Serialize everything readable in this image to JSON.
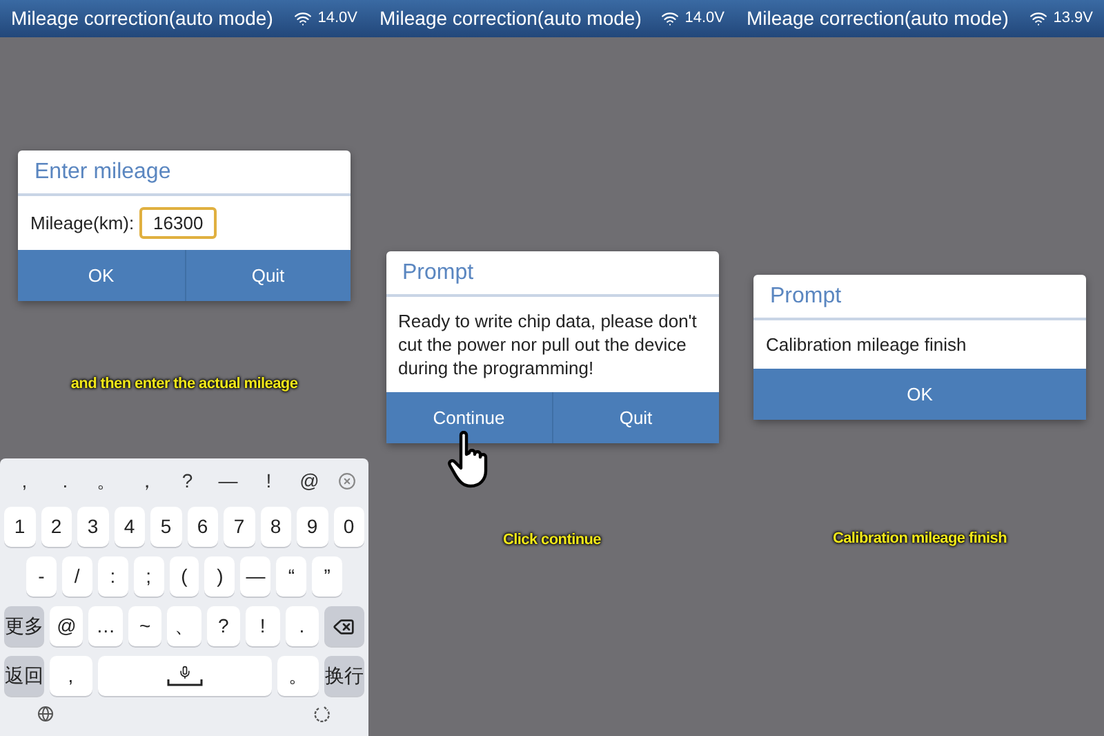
{
  "panels": [
    {
      "header": {
        "title": "Mileage correction(auto mode)",
        "voltage": "14.0V"
      },
      "dialog": {
        "kind": "input",
        "title": "Enter mileage",
        "label": "Mileage(km):",
        "value": "16300",
        "buttons": [
          "OK",
          "Quit"
        ]
      },
      "caption": "and then enter the actual mileage",
      "pointer": false
    },
    {
      "header": {
        "title": "Mileage correction(auto mode)",
        "voltage": "14.0V"
      },
      "dialog": {
        "kind": "message",
        "title": "Prompt",
        "message": "Ready to write chip data, please don't cut the power nor pull out the device during the programming!",
        "buttons": [
          "Continue",
          "Quit"
        ]
      },
      "caption": "Click continue",
      "pointer": true
    },
    {
      "header": {
        "title": "Mileage correction(auto mode)",
        "voltage": "13.9V"
      },
      "dialog": {
        "kind": "message",
        "title": "Prompt",
        "message": "Calibration mileage finish",
        "buttons": [
          "OK"
        ]
      },
      "caption": "Calibration mileage finish",
      "pointer": false
    }
  ],
  "keyboard": {
    "suggestions": [
      ",",
      ".",
      "。",
      "，",
      "?",
      "—",
      "!",
      "@"
    ],
    "rows": [
      {
        "keys": [
          {
            "kind": "char",
            "label": "1"
          },
          {
            "kind": "char",
            "label": "2"
          },
          {
            "kind": "char",
            "label": "3"
          },
          {
            "kind": "char",
            "label": "4"
          },
          {
            "kind": "char",
            "label": "5"
          },
          {
            "kind": "char",
            "label": "6"
          },
          {
            "kind": "char",
            "label": "7"
          },
          {
            "kind": "char",
            "label": "8"
          },
          {
            "kind": "char",
            "label": "9"
          },
          {
            "kind": "char",
            "label": "0"
          }
        ]
      },
      {
        "keys": [
          {
            "kind": "char",
            "label": "-"
          },
          {
            "kind": "char",
            "label": "/"
          },
          {
            "kind": "char",
            "label": ":"
          },
          {
            "kind": "char",
            "label": ";"
          },
          {
            "kind": "char",
            "label": "("
          },
          {
            "kind": "char",
            "label": ")"
          },
          {
            "kind": "char",
            "label": "—"
          },
          {
            "kind": "char",
            "label": "“"
          },
          {
            "kind": "char",
            "label": "”"
          }
        ]
      },
      {
        "keys": [
          {
            "kind": "function",
            "label": "更多"
          },
          {
            "kind": "char",
            "label": "@"
          },
          {
            "kind": "char",
            "label": "…"
          },
          {
            "kind": "char",
            "label": "~"
          },
          {
            "kind": "char",
            "label": "、"
          },
          {
            "kind": "char",
            "label": "?"
          },
          {
            "kind": "char",
            "label": "!"
          },
          {
            "kind": "char",
            "label": "."
          },
          {
            "kind": "backspace"
          }
        ]
      },
      {
        "keys": [
          {
            "kind": "function",
            "label": "返回"
          },
          {
            "kind": "char",
            "label": ","
          },
          {
            "kind": "space"
          },
          {
            "kind": "char",
            "label": "。"
          },
          {
            "kind": "function",
            "label": "换行"
          }
        ]
      }
    ]
  }
}
